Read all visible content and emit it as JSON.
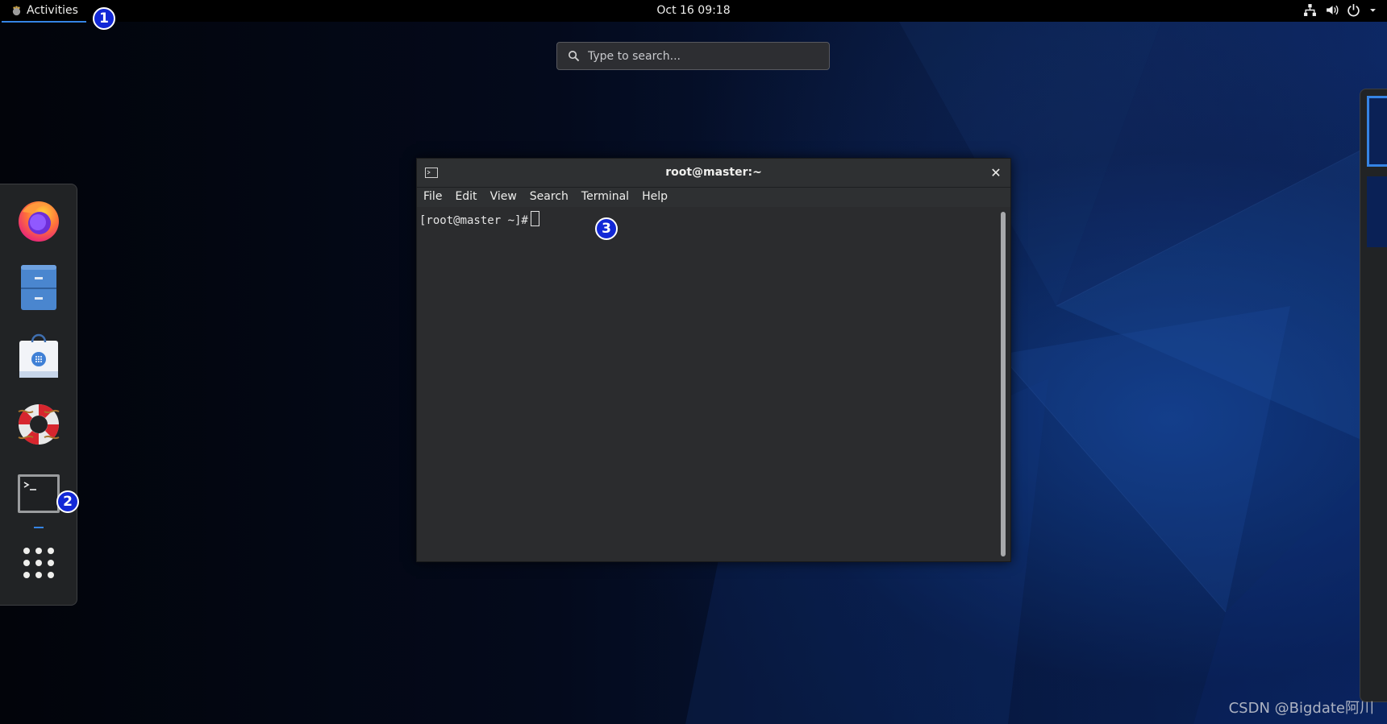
{
  "topbar": {
    "activities_label": "Activities",
    "clock": "Oct 16  09:18",
    "tray_icons": [
      "network-icon",
      "volume-icon",
      "power-icon",
      "chevron-down-icon"
    ]
  },
  "search": {
    "placeholder": "Type to search..."
  },
  "dash": {
    "apps": [
      {
        "name": "firefox-icon"
      },
      {
        "name": "files-icon"
      },
      {
        "name": "software-icon"
      },
      {
        "name": "help-icon"
      },
      {
        "name": "terminal-icon"
      },
      {
        "name": "show-applications-icon"
      }
    ]
  },
  "terminal": {
    "title": "root@master:~",
    "close_glyph": "✕",
    "menu": [
      "File",
      "Edit",
      "View",
      "Search",
      "Terminal",
      "Help"
    ],
    "prompt": "[root@master ~]#"
  },
  "annotations": [
    "1",
    "2",
    "3"
  ],
  "watermark": "CSDN @Bigdate阿川",
  "colors": {
    "badge": "#1228d6",
    "accent": "#3584e4",
    "topbar": "#000000"
  }
}
